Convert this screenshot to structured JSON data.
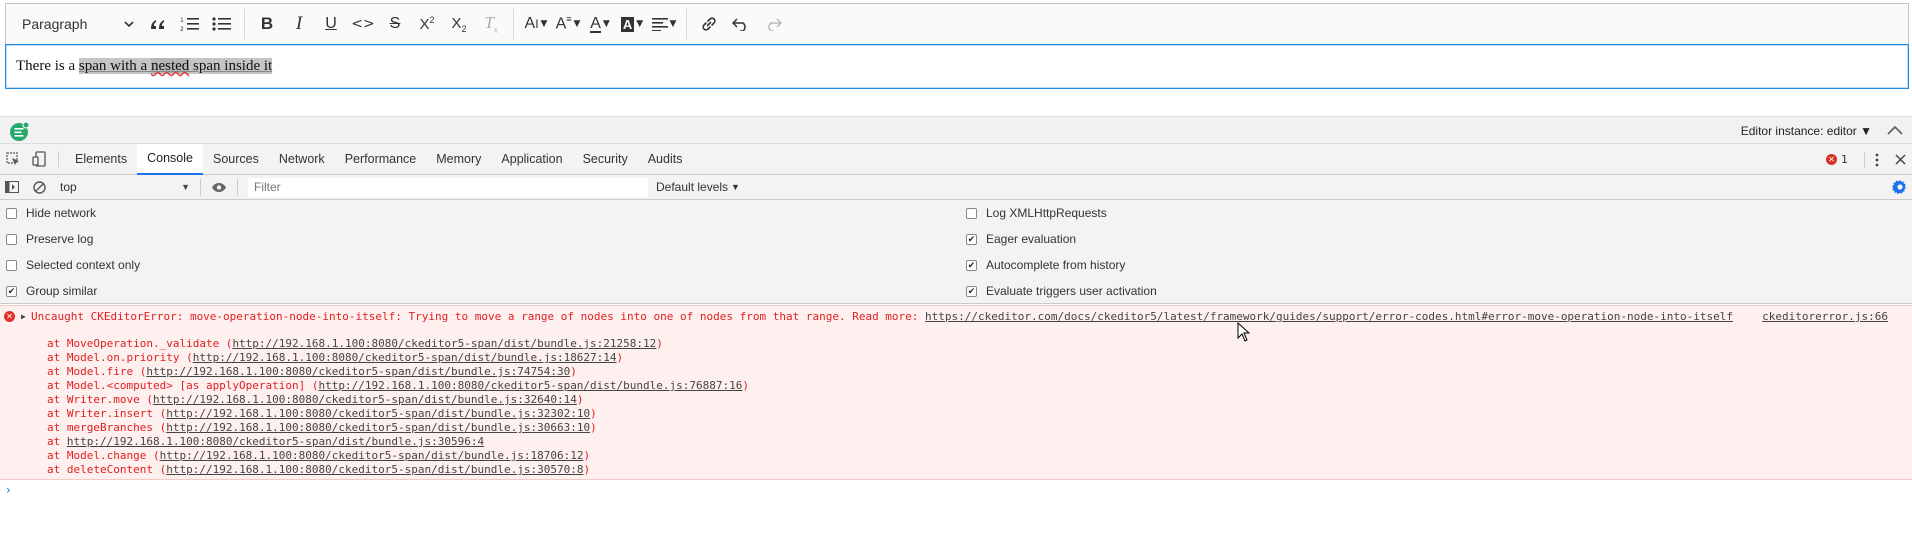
{
  "editor": {
    "toolbar": {
      "heading_label": "Paragraph",
      "buttons": [
        {
          "name": "block-quote",
          "icon": "quote-icon"
        },
        {
          "name": "numbered-list",
          "icon": "numbered-list-icon"
        },
        {
          "name": "bulleted-list",
          "icon": "bulleted-list-icon"
        },
        {
          "name": "bold",
          "icon": "bold-icon"
        },
        {
          "name": "italic",
          "icon": "italic-icon"
        },
        {
          "name": "underline",
          "icon": "underline-icon"
        },
        {
          "name": "code",
          "icon": "code-icon"
        },
        {
          "name": "strikethrough",
          "icon": "strikethrough-icon"
        },
        {
          "name": "superscript",
          "icon": "superscript-icon"
        },
        {
          "name": "subscript",
          "icon": "subscript-icon"
        },
        {
          "name": "remove-format",
          "icon": "remove-format-icon"
        },
        {
          "name": "font-size",
          "icon": "font-size-icon"
        },
        {
          "name": "font-family",
          "icon": "font-family-icon"
        },
        {
          "name": "font-color",
          "icon": "font-color-icon"
        },
        {
          "name": "font-background-color",
          "icon": "font-background-icon"
        },
        {
          "name": "alignment",
          "icon": "align-left-icon"
        },
        {
          "name": "link",
          "icon": "link-icon"
        },
        {
          "name": "undo",
          "icon": "undo-icon"
        },
        {
          "name": "redo",
          "icon": "redo-icon"
        }
      ]
    },
    "content": {
      "prefix": "There is a ",
      "span_part1": "span with a ",
      "nested": "nested",
      "span_part2": " span inside it"
    }
  },
  "inspector": {
    "instance_label": "Editor instance: editor ▼"
  },
  "devtools": {
    "tabs": [
      "Elements",
      "Console",
      "Sources",
      "Network",
      "Performance",
      "Memory",
      "Application",
      "Security",
      "Audits"
    ],
    "active_tab": "Console",
    "error_count": "1",
    "console_toolbar": {
      "context": "top",
      "filter_placeholder": "Filter",
      "levels": "Default levels"
    },
    "settings": {
      "left": [
        {
          "label": "Hide network",
          "checked": false
        },
        {
          "label": "Preserve log",
          "checked": false
        },
        {
          "label": "Selected context only",
          "checked": false
        },
        {
          "label": "Group similar",
          "checked": true
        }
      ],
      "right": [
        {
          "label": "Log XMLHttpRequests",
          "checked": false
        },
        {
          "label": "Eager evaluation",
          "checked": true
        },
        {
          "label": "Autocomplete from history",
          "checked": true
        },
        {
          "label": "Evaluate triggers user activation",
          "checked": true
        }
      ]
    },
    "error": {
      "message": "Uncaught CKEditorError: move-operation-node-into-itself: Trying to move a range of nodes into one of nodes from that range. Read more: ",
      "link": "https://ckeditor.com/docs/ckeditor5/latest/framework/guides/support/error-codes.html#error-move-operation-node-into-itself",
      "source": "ckeditorerror.js:66",
      "stack": [
        {
          "pre": "at MoveOperation._validate (",
          "link": "http://192.168.1.100:8080/ckeditor5-span/dist/bundle.js:21258:12",
          "post": ")"
        },
        {
          "pre": "at Model.on.priority (",
          "link": "http://192.168.1.100:8080/ckeditor5-span/dist/bundle.js:18627:14",
          "post": ")"
        },
        {
          "pre": "at Model.fire (",
          "link": "http://192.168.1.100:8080/ckeditor5-span/dist/bundle.js:74754:30",
          "post": ")"
        },
        {
          "pre": "at Model.<computed> [as applyOperation] (",
          "link": "http://192.168.1.100:8080/ckeditor5-span/dist/bundle.js:76887:16",
          "post": ")"
        },
        {
          "pre": "at Writer.move (",
          "link": "http://192.168.1.100:8080/ckeditor5-span/dist/bundle.js:32640:14",
          "post": ")"
        },
        {
          "pre": "at Writer.insert (",
          "link": "http://192.168.1.100:8080/ckeditor5-span/dist/bundle.js:32302:10",
          "post": ")"
        },
        {
          "pre": "at mergeBranches (",
          "link": "http://192.168.1.100:8080/ckeditor5-span/dist/bundle.js:30663:10",
          "post": ")"
        },
        {
          "pre": "at ",
          "link": "http://192.168.1.100:8080/ckeditor5-span/dist/bundle.js:30596:4",
          "post": ""
        },
        {
          "pre": "at Model.change (",
          "link": "http://192.168.1.100:8080/ckeditor5-span/dist/bundle.js:18706:12",
          "post": ")"
        },
        {
          "pre": "at deleteContent (",
          "link": "http://192.168.1.100:8080/ckeditor5-span/dist/bundle.js:30570:8",
          "post": ")"
        }
      ]
    },
    "prompt": "›"
  }
}
